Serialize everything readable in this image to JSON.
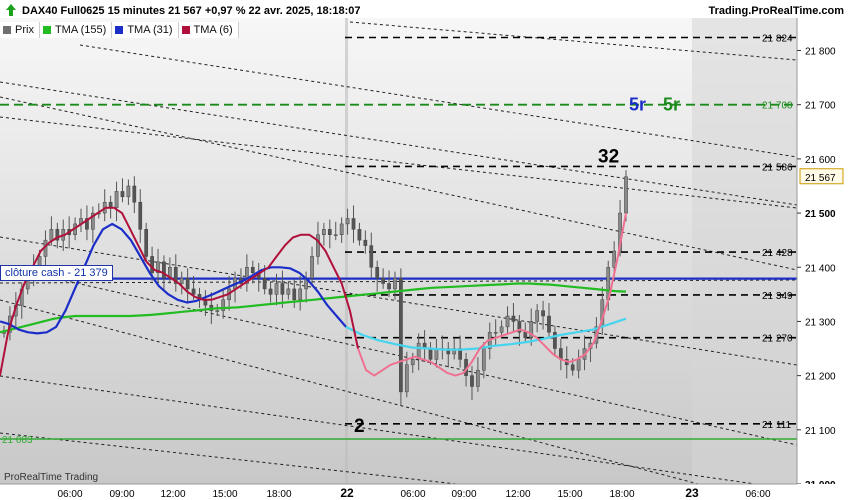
{
  "header": {
    "title": "DAX40 Full0625 15 minutes 21 567 +0,97 % 22 avr. 2025, 18:18:07",
    "brand": "Trading.ProRealTime.com"
  },
  "legend": [
    {
      "label": "Prix",
      "color": "#6f6f6f"
    },
    {
      "label": "TMA (155)",
      "color": "#22bb22"
    },
    {
      "label": "TMA (31)",
      "color": "#1c2ec8"
    },
    {
      "label": "TMA (6)",
      "color": "#b0103a"
    }
  ],
  "footer": "ProRealTime Trading",
  "cash_label": "clôture cash - 21 379",
  "chart_data": {
    "type": "candlestick",
    "ylim": [
      21000,
      21860
    ],
    "y_ticks": [
      "21 000",
      "21 100",
      "21 200",
      "21 300",
      "21 400",
      "21 500",
      "21 600",
      "21 700",
      "21 800"
    ],
    "x_ticks": [
      "06:00",
      "09:00",
      "12:00",
      "15:00",
      "18:00",
      "22",
      "06:00",
      "09:00",
      "12:00",
      "15:00",
      "18:00",
      "23",
      "06:00"
    ],
    "last_price": "21 567",
    "level_labels": [
      {
        "text": "21 824",
        "value": 21824,
        "color": "#000000"
      },
      {
        "text": "21 700",
        "value": 21700,
        "color": "#1a8a1a"
      },
      {
        "text": "21 586",
        "value": 21586,
        "color": "#000000"
      },
      {
        "text": "21 428",
        "value": 21428,
        "color": "#000000"
      },
      {
        "text": "21 349",
        "value": 21349,
        "color": "#000000"
      },
      {
        "text": "21 270",
        "value": 21270,
        "color": "#000000"
      },
      {
        "text": "21 111",
        "value": 21111,
        "color": "#000000"
      },
      {
        "text": "21 083",
        "value": 21083,
        "color": "#33aa33"
      }
    ],
    "annotations": [
      {
        "text": "32",
        "color": "#000000"
      },
      {
        "text": "2",
        "color": "#000000"
      },
      {
        "text": "5r",
        "color": "#1c2ec8"
      },
      {
        "text": "5r",
        "color": "#1a8a1a"
      }
    ],
    "cash_close": 21379,
    "price_close": [
      21280,
      21310,
      21330,
      21360,
      21380,
      21400,
      21420,
      21450,
      21470,
      21450,
      21470,
      21460,
      21480,
      21490,
      21470,
      21500,
      21500,
      21520,
      21510,
      21540,
      21530,
      21550,
      21520,
      21470,
      21420,
      21390,
      21410,
      21380,
      21400,
      21370,
      21380,
      21360,
      21350,
      21340,
      21330,
      21320,
      21320,
      21340,
      21360,
      21380,
      21370,
      21400,
      21390,
      21380,
      21360,
      21350,
      21370,
      21350,
      21360,
      21340,
      21360,
      21380,
      21420,
      21460,
      21470,
      21460,
      21460,
      21480,
      21490,
      21470,
      21450,
      21440,
      21400,
      21380,
      21370,
      21360,
      21380,
      21170,
      21220,
      21230,
      21260,
      21250,
      21230,
      21250,
      21250,
      21240,
      21250,
      21230,
      21200,
      21180,
      21210,
      21250,
      21280,
      21280,
      21290,
      21310,
      21300,
      21280,
      21270,
      21300,
      21320,
      21310,
      21280,
      21250,
      21230,
      21220,
      21210,
      21230,
      21250,
      21260,
      21290,
      21340,
      21400,
      21430,
      21500,
      21567
    ],
    "tma155": [
      21280,
      21285,
      21290,
      21295,
      21300,
      21305,
      21308,
      21310,
      21310,
      21310,
      21310,
      21310,
      21310,
      21311,
      21312,
      21314,
      21316,
      21318,
      21320,
      21322,
      21324,
      21325,
      21326,
      21328,
      21330,
      21332,
      21334,
      21336,
      21338,
      21340,
      21342,
      21344,
      21346,
      21348,
      21350,
      21352,
      21354,
      21356,
      21358,
      21360,
      21362,
      21363,
      21364,
      21365,
      21366,
      21367,
      21368,
      21369,
      21370,
      21370,
      21369,
      21368,
      21366,
      21364,
      21362,
      21360,
      21358,
      21356,
      21355
    ],
    "tma31": [
      21300,
      21295,
      21285,
      21280,
      21278,
      21280,
      21290,
      21320,
      21360,
      21400,
      21440,
      21470,
      21480,
      21470,
      21450,
      21420,
      21390,
      21365,
      21350,
      21340,
      21335,
      21338,
      21345,
      21352,
      21360,
      21368,
      21375,
      21385,
      21395,
      21400,
      21400,
      21398,
      21390,
      21375,
      21355,
      21330,
      21310,
      21290,
      21275,
      21265,
      21258,
      21252,
      21250,
      21248,
      21248,
      21250,
      21255,
      21258,
      21262,
      21268,
      21275,
      21280,
      21285,
      21295,
      21305
    ],
    "tma6": [
      21200,
      21280,
      21330,
      21370,
      21400,
      21430,
      21445,
      21455,
      21460,
      21470,
      21480,
      21490,
      21500,
      21510,
      21510,
      21500,
      21470,
      21440,
      21410,
      21395,
      21390,
      21380,
      21370,
      21355,
      21345,
      21340,
      21340,
      21345,
      21350,
      21360,
      21370,
      21380,
      21390,
      21400,
      21420,
      21440,
      21455,
      21460,
      21460,
      21450,
      21430,
      21400,
      21370,
      21320,
      21250,
      21210,
      21200,
      21210,
      21220,
      21225,
      21230,
      21235,
      21230,
      21225,
      21215,
      21205,
      21200,
      21205,
      21225,
      21250,
      21265,
      21270,
      21275,
      21280,
      21285,
      21280,
      21270,
      21255,
      21240,
      21230,
      21225,
      21230,
      21240,
      21260,
      21300,
      21350,
      21420,
      21500
    ]
  }
}
